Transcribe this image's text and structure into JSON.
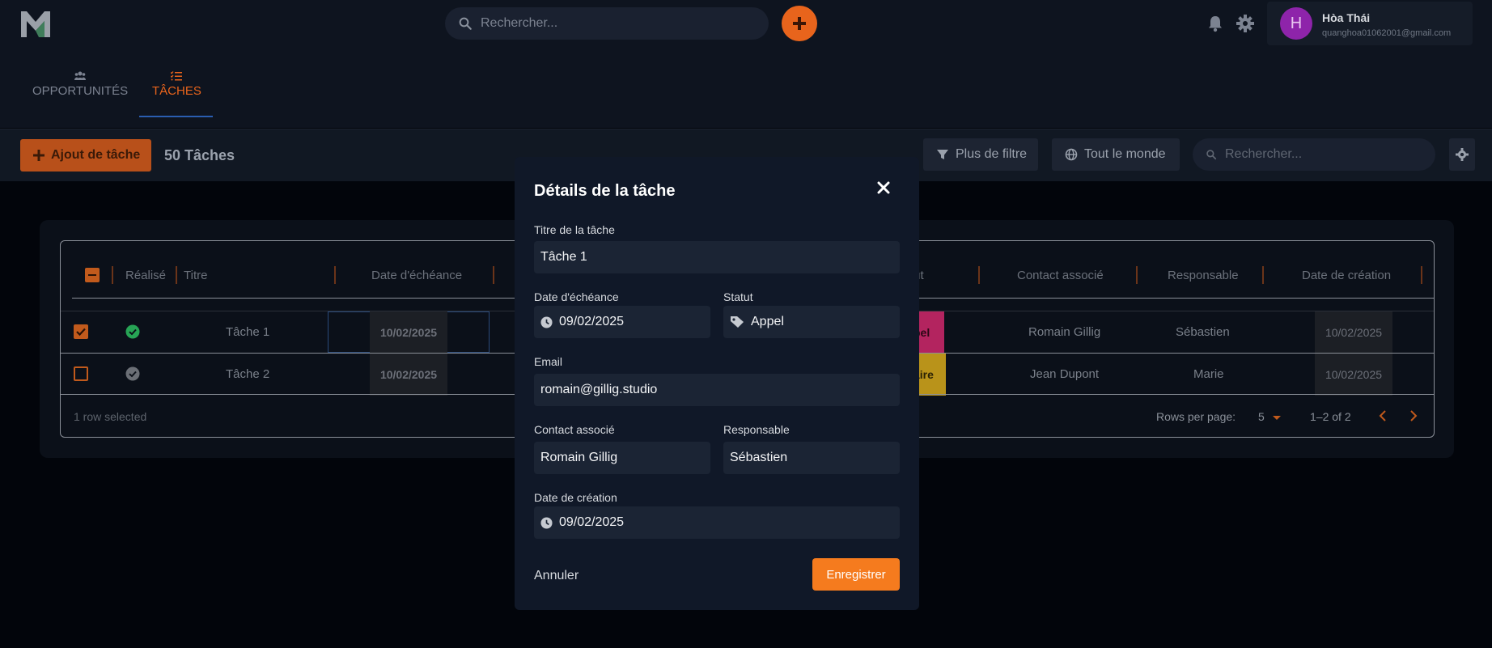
{
  "topbar": {
    "search_placeholder": "Rechercher...",
    "user": {
      "initial": "H",
      "name": "Hòa Thái",
      "email": "quanghoa01062001@gmail.com"
    }
  },
  "tabs": [
    {
      "label": "OPPORTUNITÉS",
      "icon": "people-icon",
      "active": false
    },
    {
      "label": "TÂCHES",
      "icon": "task-list-icon",
      "active": true
    }
  ],
  "toolbar": {
    "add_label": "Ajout de tâche",
    "count_label": "50 Tâches",
    "filter_label": "Plus de filtre",
    "everyone_label": "Tout le monde",
    "search_placeholder": "Rechercher..."
  },
  "grid": {
    "columns": [
      "Réalisé",
      "Titre",
      "Date d'échéance",
      "tut",
      "Contact associé",
      "Responsable",
      "Date de création"
    ],
    "rows": [
      {
        "selected": true,
        "done": true,
        "title": "Tâche 1",
        "due": "10/02/2025",
        "status": "pel",
        "status_color": "#b3245f",
        "contact": "Romain Gillig",
        "owner": "Sébastien",
        "created": "10/02/2025"
      },
      {
        "selected": false,
        "done": false,
        "title": "Tâche 2",
        "due": "10/02/2025",
        "status": "aire",
        "status_color": "#b9931a",
        "contact": "Jean Dupont",
        "owner": "Marie",
        "created": "10/02/2025"
      }
    ],
    "footer": {
      "selected_text": "1 row selected",
      "rows_per_page_label": "Rows per page:",
      "rows_per_page": "5",
      "range": "1–2 of 2"
    }
  },
  "modal": {
    "title": "Détails de la tâche",
    "fields": {
      "title_label": "Titre de la tâche",
      "title_value": "Tâche 1",
      "due_label": "Date d'échéance",
      "due_value": "09/02/2025",
      "status_label": "Statut",
      "status_value": "Appel",
      "email_label": "Email",
      "email_value": "romain@gillig.studio",
      "contact_label": "Contact associé",
      "contact_value": "Romain Gillig",
      "owner_label": "Responsable",
      "owner_value": "Sébastien",
      "created_label": "Date de création",
      "created_value": "09/02/2025"
    },
    "cancel_label": "Annuler",
    "save_label": "Enregistrer"
  },
  "colors": {
    "accent": "#e8641c",
    "save": "#f57b1e",
    "modal_bg": "#101828"
  }
}
